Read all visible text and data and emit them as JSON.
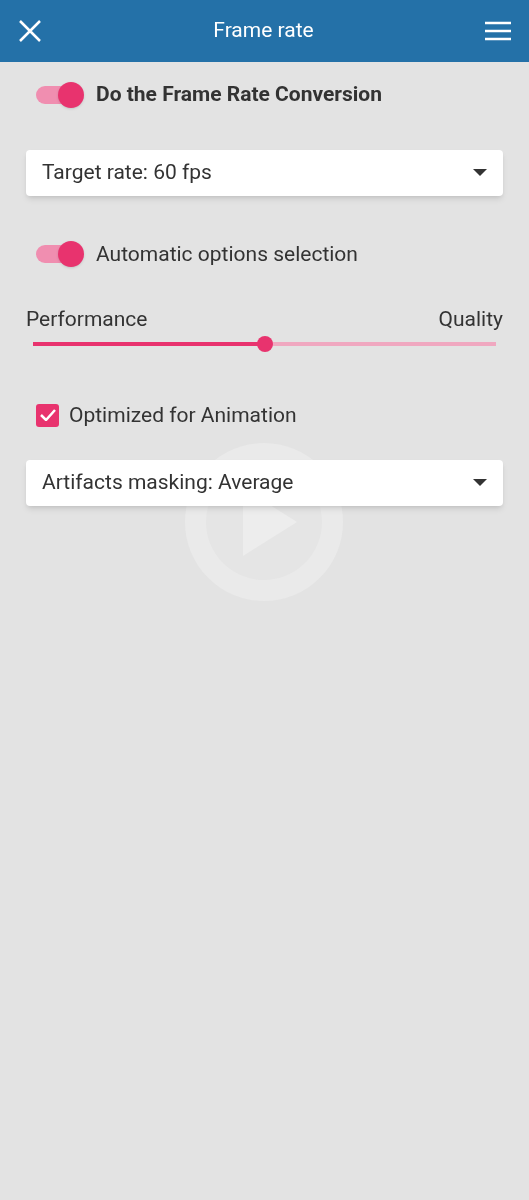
{
  "header": {
    "title": "Frame rate"
  },
  "conversion": {
    "label": "Do the Frame Rate Conversion",
    "on": true
  },
  "target_rate": {
    "value": "Target rate: 60 fps"
  },
  "auto_options": {
    "label": "Automatic options selection",
    "on": true
  },
  "slider": {
    "left_label": "Performance",
    "right_label": "Quality",
    "level": 0.5
  },
  "animation": {
    "label": "Optimized for Animation",
    "checked": true
  },
  "artifacts": {
    "value": "Artifacts masking: Average"
  }
}
